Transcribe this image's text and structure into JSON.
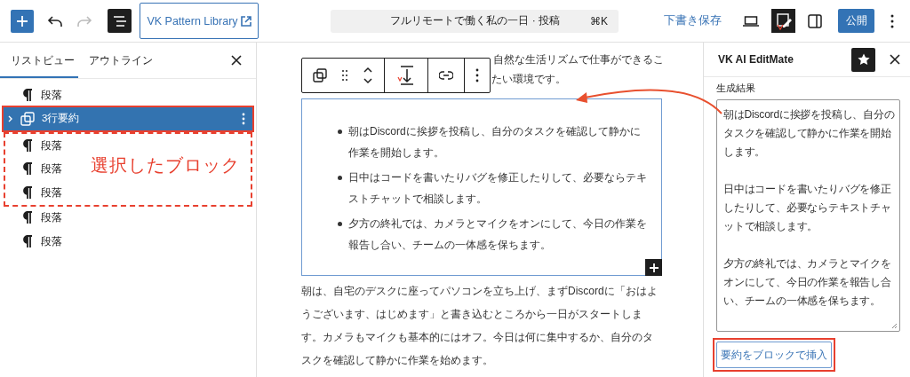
{
  "header": {
    "pattern_library": "VK Pattern Library",
    "document_title": "フルリモートで働く私の一日 · 投稿",
    "shortcut": "⌘K",
    "save_draft": "下書き保存",
    "publish": "公開",
    "redo_disabled": true,
    "list_view_on": true
  },
  "list_panel": {
    "tabs": [
      {
        "label": "リストビュー",
        "selected": true
      },
      {
        "label": "アウトライン",
        "selected": false
      }
    ],
    "items": [
      {
        "label": "段落",
        "kind": "paragraph",
        "selected": false
      },
      {
        "label": "3行要約",
        "kind": "group",
        "selected": true,
        "expanded": false
      },
      {
        "label": "段落",
        "kind": "paragraph",
        "selected": false
      },
      {
        "label": "段落",
        "kind": "paragraph",
        "selected": false
      },
      {
        "label": "段落",
        "kind": "paragraph",
        "selected": false
      },
      {
        "label": "段落",
        "kind": "paragraph",
        "selected": false
      },
      {
        "label": "段落",
        "kind": "paragraph",
        "selected": false
      }
    ]
  },
  "annotation": {
    "label": "選択したブロック"
  },
  "editor": {
    "paragraph_before_fragments": [
      "自然な生活リズムで仕事ができるこ",
      "たい環境です。"
    ],
    "list_items": [
      "朝はDiscordに挨拶を投稿し、自分のタスクを確認して静かに作業を開始します。",
      "日中はコードを書いたりバグを修正したりして、必要ならテキストチャットで相談します。",
      "夕方の終礼では、カメラとマイクをオンにして、今日の作業を報告し合い、チームの一体感を保ちます。"
    ],
    "paragraphs_after": [
      "朝は、自宅のデスクに座ってパソコンを立ち上げ、まずDiscordに「おはようございます、はじめます」と書き込むところから一日がスタートします。カメラもマイクも基本的にはオフ。今日は何に集中するか、自分のタスクを確認して静かに作業を始めます。"
    ]
  },
  "sidebar": {
    "title": "VK AI EditMate",
    "result_label": "生成結果",
    "result_paragraphs": [
      "朝はDiscordに挨拶を投稿し、自分のタスクを確認して静かに作業を開始します。",
      "日中はコードを書いたりバグを修正したりして、必要ならテキストチャットで相談します。",
      "夕方の終礼では、カメラとマイクをオンにして、今日の作業を報告し合い、チームの一体感を保ちます。"
    ],
    "insert_button": "要約をブロックで挿入"
  }
}
